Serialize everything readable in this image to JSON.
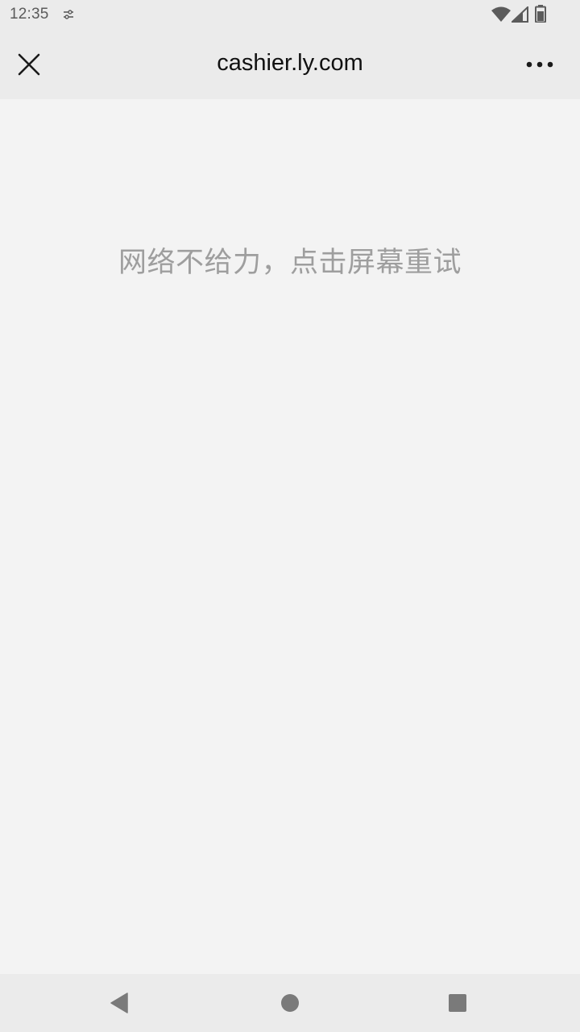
{
  "status_bar": {
    "time": "12:35",
    "icons": [
      "settings-icon",
      "wifi-icon",
      "signal-icon",
      "battery-icon"
    ]
  },
  "title_bar": {
    "title": "cashier.ly.com",
    "close_icon": "close-icon",
    "more_icon": "more-icon"
  },
  "content": {
    "error_message": "网络不给力，点击屏幕重试"
  },
  "nav_bar": {
    "icons": [
      "back-icon",
      "home-icon",
      "recents-icon"
    ]
  },
  "colors": {
    "background": "#f3f3f3",
    "bars": "#ebebeb",
    "message_text": "#9e9e9e",
    "title_text": "#111111"
  }
}
